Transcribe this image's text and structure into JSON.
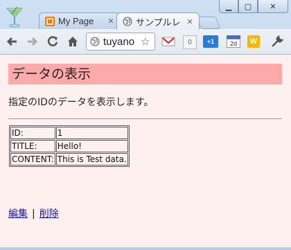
{
  "tabs": [
    {
      "title": "My Page",
      "favicon": "blogger-like-icon",
      "active": false
    },
    {
      "title": "サンプルレ",
      "favicon": "globe-icon",
      "active": true
    }
  ],
  "toolbar": {
    "url": "tuyano",
    "extension_badges": {
      "count": "0",
      "plus_one": "+1",
      "calendar_day": "2d",
      "w": "W"
    }
  },
  "page": {
    "heading": "データの表示",
    "description": "指定のIDのデータを表示します。",
    "table": [
      {
        "label": "ID:",
        "value": "1"
      },
      {
        "label": "TITLE:",
        "value": "Hello!"
      },
      {
        "label": "CONTENT:",
        "value": "This is Test data."
      }
    ],
    "links": {
      "edit": "編集",
      "separator": "|",
      "delete": "削除"
    }
  },
  "colors": {
    "heading_bg": "#ffaaaa",
    "page_bg": "#fff0f0"
  }
}
